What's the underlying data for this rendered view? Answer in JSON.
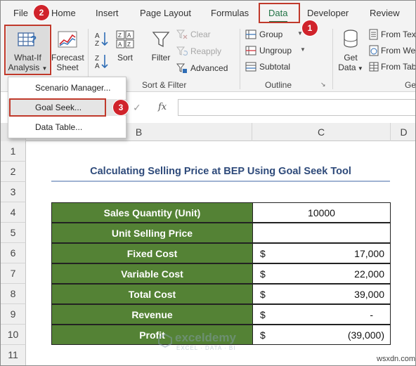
{
  "tabs": [
    {
      "label": "File"
    },
    {
      "label": "Home"
    },
    {
      "label": "Insert"
    },
    {
      "label": "Page Layout"
    },
    {
      "label": "Formulas"
    },
    {
      "label": "Data"
    },
    {
      "label": "Developer"
    },
    {
      "label": "Review"
    }
  ],
  "active_tab": "Data",
  "step_badges": [
    "1",
    "2",
    "3"
  ],
  "ribbon": {
    "what_if": {
      "line1": "What-If",
      "line2": "Analysis"
    },
    "forecast": {
      "line1": "Forecast",
      "line2": "Sheet"
    },
    "sort": "Sort",
    "filter": "Filter",
    "clear": "Clear",
    "reapply": "Reapply",
    "advanced": "Advanced",
    "sort_filter_group": "Sort & Filter",
    "group": "Group",
    "ungroup": "Ungroup",
    "subtotal": "Subtotal",
    "outline_group": "Outline",
    "get_data": {
      "line1": "Get",
      "line2": "Data"
    },
    "from_text": "From Text",
    "from_web": "From We",
    "from_table": "From Tab",
    "get_group_partial": "Ge"
  },
  "whatif_menu": [
    {
      "label": "Scenario Manager..."
    },
    {
      "label": "Goal Seek..."
    },
    {
      "label": "Data Table..."
    }
  ],
  "formula_bar": {
    "fx": "fx",
    "value": ""
  },
  "columns": [
    "B",
    "C",
    "D"
  ],
  "rows": [
    "1",
    "2",
    "3",
    "4",
    "5",
    "6",
    "7",
    "8",
    "9",
    "10",
    "11"
  ],
  "sheet": {
    "title": "Calculating Selling Price at BEP Using Goal Seek Tool",
    "table": [
      {
        "label": "Sales Quantity (Unit)",
        "currency": "",
        "value": "10000"
      },
      {
        "label": "Unit Selling Price",
        "currency": "",
        "value": ""
      },
      {
        "label": "Fixed Cost",
        "currency": "$",
        "value": "17,000"
      },
      {
        "label": "Variable Cost",
        "currency": "$",
        "value": "22,000"
      },
      {
        "label": "Total Cost",
        "currency": "$",
        "value": "39,000"
      },
      {
        "label": "Revenue",
        "currency": "$",
        "value": "-"
      },
      {
        "label": "Profit",
        "currency": "$",
        "value": "(39,000)"
      }
    ]
  },
  "watermark": {
    "name": "exceldemy",
    "tagline": "EXCEL · DATA · BI"
  },
  "corner_mark": "wsxdn.com",
  "colors": {
    "accent": "#217346",
    "table_label_fill": "#548235",
    "highlight": "#c0392b",
    "title_text": "#2e4a7a"
  }
}
